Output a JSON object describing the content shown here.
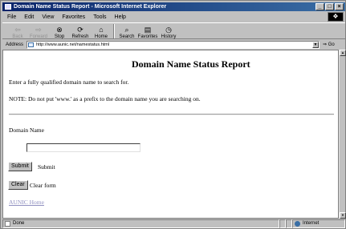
{
  "window": {
    "title": "Domain Name Status Report - Microsoft Internet Explorer",
    "controls": {
      "minimize": "_",
      "maximize": "□",
      "close": "×"
    }
  },
  "menu": [
    "File",
    "Edit",
    "View",
    "Favorites",
    "Tools",
    "Help"
  ],
  "toolbar": {
    "back": "Back",
    "forward": "Forward",
    "stop": "Stop",
    "refresh": "Refresh",
    "home": "Home",
    "search": "Search",
    "favorites": "Favorites",
    "history": "History"
  },
  "address": {
    "label": "Address",
    "url": "http://www.aunic.net/namestatus.html",
    "go": "Go"
  },
  "page": {
    "title": "Domain Name Status Report",
    "intro": "Enter a fully qualified domain name to search for.",
    "note": "NOTE: Do not put 'www.' as a prefix to the domain name you are searching on.",
    "field_label": "Domain Name",
    "field_value": "",
    "submit_button": "Submit",
    "submit_text": "Submit",
    "clear_button": "Clear",
    "clear_text": "Clear form",
    "link": "AUNIC Home"
  },
  "status": {
    "text": "Done",
    "zone": "Internet"
  }
}
